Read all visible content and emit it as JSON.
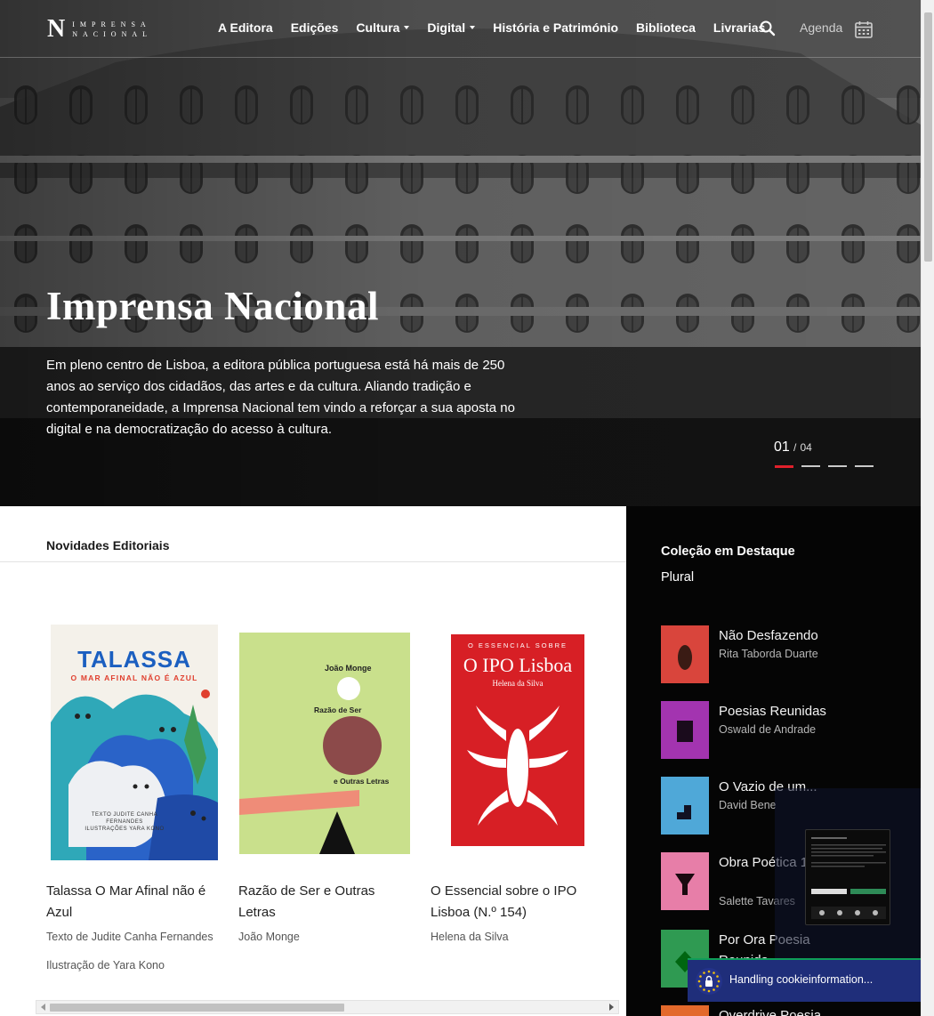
{
  "header": {
    "logo_letter": "N",
    "logo_line1": "IMPRENSA",
    "logo_line2": "NACIONAL",
    "nav": [
      {
        "label": "A Editora",
        "dropdown": false
      },
      {
        "label": "Edições",
        "dropdown": false
      },
      {
        "label": "Cultura",
        "dropdown": true
      },
      {
        "label": "Digital",
        "dropdown": true
      },
      {
        "label": "História e Património",
        "dropdown": false
      },
      {
        "label": "Biblioteca",
        "dropdown": false
      },
      {
        "label": "Livrarias",
        "dropdown": false
      }
    ],
    "search_icon": "search-icon",
    "agenda_label": "Agenda",
    "calendar_icon": "calendar-icon"
  },
  "hero": {
    "title": "Imprensa Nacional",
    "text": "Em pleno centro de Lisboa,  a editora pública portuguesa está há mais de 250 anos ao serviço dos cidadãos, das artes e da cultura. Aliando tradição e contemporaneidade, a Imprensa Nacional tem vindo a reforçar a sua aposta no digital e na democratização do acesso à cultura.",
    "slide_current": "01",
    "slide_separator": "/",
    "slide_total": "04",
    "active_color": "#e0202b"
  },
  "news": {
    "heading": "Novidades Editoriais",
    "books": [
      {
        "title": "Talassa O Mar Afinal não é Azul",
        "author_line1": "Texto de Judite Canha Fernandes",
        "author_line2": "Ilustração de Yara Kono",
        "cover_title": "TALASSA",
        "cover_subtitle": "O MAR AFINAL NÃO É AZUL",
        "cover_credits": "TEXTO JUDITE CANHA FERNANDES ILUSTRAÇÕES YARA KONO"
      },
      {
        "title": "Razão de Ser e Outras Letras",
        "author_line1": "João Monge",
        "author_line2": "",
        "cover_author": "João Monge",
        "cover_title1": "Razão de Ser",
        "cover_title2": "e Outras Letras"
      },
      {
        "title": "O Essencial sobre o IPO Lisboa (N.º 154)",
        "author_line1": "Helena da Silva",
        "author_line2": "",
        "cover_kicker": "O ESSENCIAL SOBRE",
        "cover_title": "O IPO Lisboa",
        "cover_author": "Helena da Silva"
      }
    ]
  },
  "collection": {
    "heading": "Coleção em Destaque",
    "name": "Plural",
    "items": [
      {
        "title": "Não Desfazendo",
        "author": "Rita Taborda Duarte",
        "color": "#d9453c"
      },
      {
        "title": "Poesias Reunidas",
        "author": "Oswald de Andrade",
        "color": "#a334b0"
      },
      {
        "title": "O Vazio de um...",
        "author": "David Bene",
        "color": "#4fa8d8"
      },
      {
        "title": "Obra Poética 1994",
        "author": "Salette Tavares",
        "color": "#e77ea8"
      },
      {
        "title": "Por Ora Poesia Reunida",
        "author": "",
        "color": "#2f9a52"
      },
      {
        "title": "Overdrive Poesia",
        "author": "",
        "color": "#e3692b"
      }
    ]
  },
  "cookie": {
    "label": "Handling cookieinformation..."
  }
}
